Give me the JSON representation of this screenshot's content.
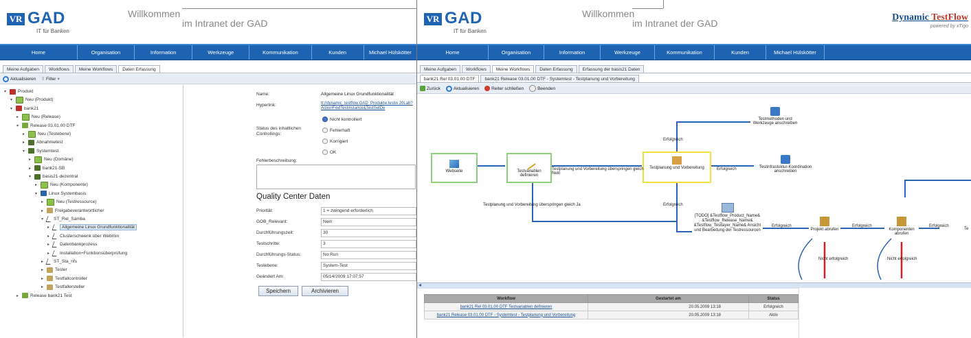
{
  "brand": {
    "logo_mark": "VR",
    "logo_text": "GAD",
    "logo_sub": "IT für Banken",
    "welcome": "Willkommen",
    "intranet": "im Intranet der GAD"
  },
  "dtf": {
    "title_a": "Dynamic ",
    "title_b": "TestFlow",
    "sub": "powered by xTigo"
  },
  "nav": [
    "Home",
    "Organisation",
    "Information",
    "Werkzeuge",
    "Kommunikation",
    "Kunden",
    "Michael Hülskötter"
  ],
  "left": {
    "tabs": [
      "Meine Aufgaben",
      "Workflows",
      "Meine Workflows",
      "Daten Erfassung"
    ],
    "toolbar": {
      "refresh": "Aktualisieren",
      "filter": "Filter"
    },
    "tree": [
      "Produkt",
      "Neu (Produkt)",
      "bank21",
      "Neu (Release)",
      "Release 03.01.00 DTF",
      "Neu (Testebene)",
      "Abnahmetest",
      "Systemtest",
      "Neu (Domäne)",
      "bank21-SB",
      "basis21-dezentral",
      "Neu (Komponente)",
      "Linux Systembasis",
      "Neu (Testressource)",
      "Freigabeverantwortlicher",
      "ST_Rel_Samba",
      "Allgemeine Linux Grundfunktionalität",
      "Clusterschwenk über Webmin",
      "Datenbankprozess",
      "Installation+Funktionsüberprüfung",
      "ST_Sta_nfs",
      "Tester",
      "Testfallcontroller",
      "Testfallersteller",
      "Release bank21 Test"
    ],
    "form": {
      "name_label": "Name:",
      "name_value": "Allgemeine Linux Grundfunktionalität",
      "hyperlink_label": "Hyperlink:",
      "hyperlink_value": "tt://dynamic_testflow.GAD_Produkte.testin 20Lab?ActionFindTestinstance&TestSetDe",
      "status_label": "Status des inhaltlichen Controllings:",
      "status_options": [
        "Nicht kontrolliert",
        "Fehlerhaft",
        "Korrigiert",
        "OK"
      ],
      "fehler_label": "Fehlerbeschreibung:",
      "qc_title": "Quality Center Daten",
      "fields": [
        {
          "label": "Priorität:",
          "value": "1 = zwingend erforderlich"
        },
        {
          "label": "GOB_Relevant:",
          "value": "Nein"
        },
        {
          "label": "Durchführungszeit:",
          "value": "30"
        },
        {
          "label": "Testschritte:",
          "value": "3"
        },
        {
          "label": "Durchführungs-Status:",
          "value": "No Run"
        },
        {
          "label": "Testebene:",
          "value": "System-Test"
        },
        {
          "label": "Geändert Am:",
          "value": "05/14/2009 17:07:57"
        }
      ],
      "save": "Speichern",
      "archive": "Archivieren"
    }
  },
  "right": {
    "tabs": [
      "Meine Aufgaben",
      "Workflows",
      "Meine Workflows",
      "Daten Erfassung",
      "Erfassung der basis21 Daten"
    ],
    "subtabs": [
      "bank21 Rel 03.01.00 DTF",
      "bank21 Release 03.01.00 DTF - Systemtest - Testplanung und Vorbereitung"
    ],
    "toolbar": {
      "back": "Zurück",
      "refresh": "Aktualisieren",
      "close": "Reiter schließen",
      "end": "Beenden"
    },
    "diagram": {
      "nodes": {
        "website": "Webseite",
        "testvars": "Testvariablen definieren",
        "planning": "Testplanung und Vorbereitung",
        "methods": "Testmethoden und Werkzeuge anschreiben",
        "infra": "Testinfrastuktur-Koordination anschreiben",
        "todo": "[TODO] &Testflow_Product_Name& &Testflow_Release_Name& &Testflow_Testlayer_Name& Ansicht und Bearbeitung der Testressourcen",
        "project": "Projekt abrufen",
        "components": "Komponenten abrufen"
      },
      "labels": {
        "skip1": "Testplanung und Vorbereitung überspringen gleich Nein",
        "skip2": "Testplanung und Vorbereitung überspringen gleich Ja",
        "ok": "Erfolgreich",
        "fail": "Nicht erfolgreich",
        "te": "Te"
      }
    },
    "table": {
      "headers": [
        "Workflow",
        "Gestartet am",
        "Status"
      ],
      "rows": [
        {
          "workflow": "bank21 Rel 03.01.00 DTF Testvariablen definieren",
          "started": "20.05.2009 13:18",
          "status": "Erfolgreich"
        },
        {
          "workflow": "bank21 Release 03.01.00 DTF - Systemtest - Testplanung und Vorbereitung",
          "started": "20.05.2009 13:18",
          "status": "Aktiv"
        }
      ]
    }
  }
}
